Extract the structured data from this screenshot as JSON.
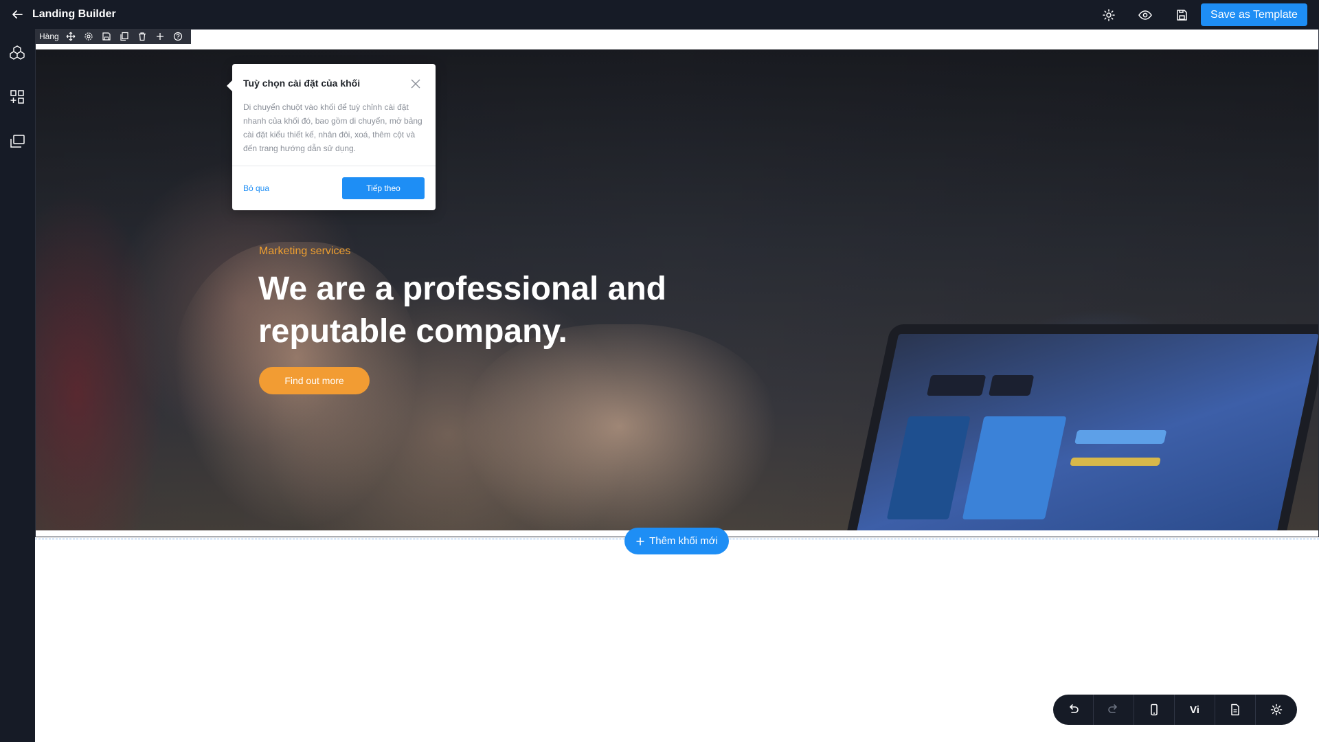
{
  "topbar": {
    "back_icon": "arrow-left-icon",
    "title": "Landing Builder",
    "icons": [
      "gear-icon",
      "eye-icon",
      "save-disk-icon"
    ],
    "save_template_label": "Save as Template"
  },
  "sidebar": {
    "items": [
      {
        "icon": "blocks-cube-icon"
      },
      {
        "icon": "grid-plus-icon"
      },
      {
        "icon": "layers-icon"
      }
    ]
  },
  "row_toolbar": {
    "label": "Hàng",
    "icons": [
      "move-icon",
      "gear-icon",
      "save-icon",
      "duplicate-icon",
      "trash-icon",
      "plus-icon",
      "help-icon"
    ]
  },
  "popover": {
    "title": "Tuỳ chọn cài đặt của khối",
    "body": "Di chuyển chuột vào khối để tuỳ chỉnh cài đặt nhanh của khối đó, bao gồm di chuyển, mở bảng cài đặt kiểu thiết kế, nhân đôi, xoá, thêm cột và đến trang hướng dẫn sử dụng.",
    "skip_label": "Bỏ qua",
    "next_label": "Tiếp theo"
  },
  "hero": {
    "eyebrow": "Marketing services",
    "headline": "We are a professional and reputable company.",
    "cta_label": "Find out more"
  },
  "add_block_label": "Thêm khối mới",
  "bottom_bar": {
    "items": [
      "undo-icon",
      "redo-icon",
      "mobile-icon",
      "language",
      "page-icon",
      "gear-icon"
    ],
    "language_label": "Vi"
  },
  "colors": {
    "dark": "#161b26",
    "primary": "#1e8ef5",
    "accent": "#f29c33"
  }
}
